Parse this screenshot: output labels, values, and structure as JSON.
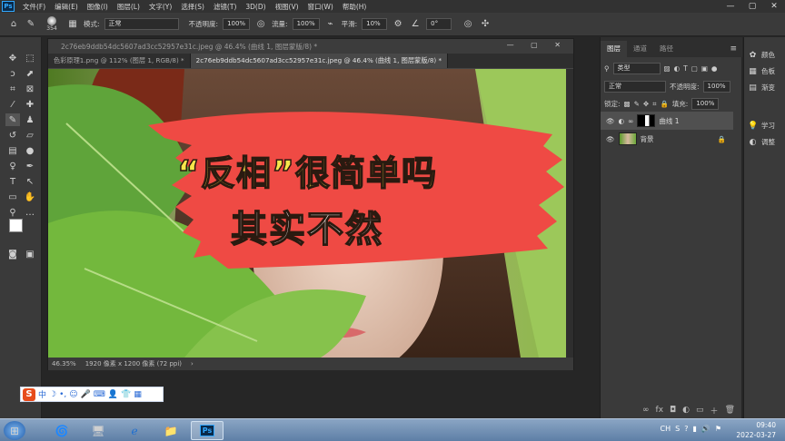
{
  "app": {
    "logo": "Ps",
    "menu": [
      "文件(F)",
      "编辑(E)",
      "图像(I)",
      "图层(L)",
      "文字(Y)",
      "选择(S)",
      "滤镜(T)",
      "3D(D)",
      "视图(V)",
      "窗口(W)",
      "帮助(H)"
    ],
    "window_controls": [
      "—",
      "▢",
      "✕"
    ]
  },
  "options_bar": {
    "brush_size": "354",
    "mode_label": "模式:",
    "mode_value": "正常",
    "opacity_label": "不透明度:",
    "opacity_value": "100%",
    "flow_label": "流量:",
    "flow_value": "100%",
    "smooth_label": "平滑:",
    "smooth_value": "10%",
    "angle_value": "0°"
  },
  "document": {
    "window_title": "2c76eb9ddb54dc5607ad3cc52957e31c.jpeg @ 46.4% (曲线 1, 图层蒙版/8) *",
    "tabs": [
      {
        "label": "色彩原理1.png @ 112% (图层 1, RGB/8) *",
        "active": false
      },
      {
        "label": "2c76eb9ddb54dc5607ad3cc52957e31c.jpeg @ 46.4% (曲线 1, 图层蒙版/8) *",
        "active": true
      }
    ],
    "zoom": "46.35%",
    "size_info": "1920 像素 x 1200 像素 (72 ppi)",
    "overlay_line1": "“反相”很简单吗",
    "overlay_line2": "其实不然"
  },
  "layers_panel": {
    "tabs": [
      "图层",
      "通道",
      "路径"
    ],
    "filter_label": "类型",
    "blend_mode": "正常",
    "opacity_label": "不透明度:",
    "opacity_value": "100%",
    "lock_label": "锁定:",
    "fill_label": "填充:",
    "fill_value": "100%",
    "layers": [
      {
        "name": "曲线 1",
        "selected": true
      },
      {
        "name": "背景",
        "selected": false
      }
    ]
  },
  "dock": {
    "items": [
      {
        "icon": "color-wheel-icon",
        "label": "颜色"
      },
      {
        "icon": "swatches-icon",
        "label": "色板"
      },
      {
        "icon": "gradient-icon",
        "label": "渐变"
      },
      {
        "icon": "learn-icon",
        "label": "学习"
      },
      {
        "icon": "adjust-icon",
        "label": "调整"
      }
    ]
  },
  "taskbar": {
    "time": "09:40",
    "date": "2022-03-27",
    "lang": "CH",
    "ps_label": "Ps"
  },
  "colors": {
    "overlay_red": "#ef4a44",
    "overlay_text_yellow": "#f7e64a",
    "ps_blue": "#31a8ff"
  }
}
